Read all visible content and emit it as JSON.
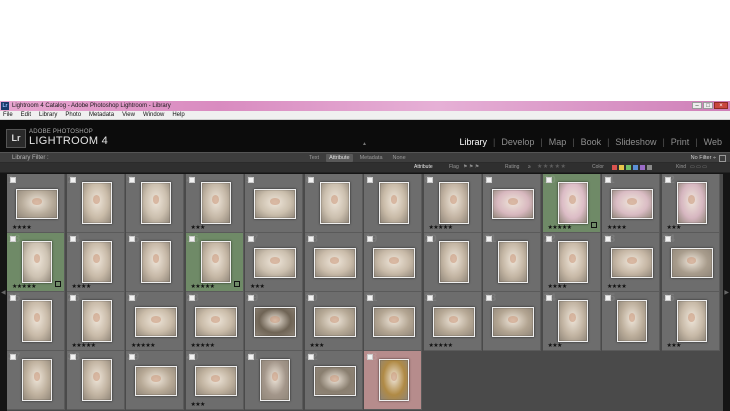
{
  "window": {
    "app_icon": "Lr",
    "title": "Lightroom 4 Catalog - Adobe Photoshop Lightroom - Library"
  },
  "menu": [
    "File",
    "Edit",
    "Library",
    "Photo",
    "Metadata",
    "View",
    "Window",
    "Help"
  ],
  "identity": {
    "logo": "Lr",
    "brand_line1": "ADOBE PHOTOSHOP",
    "brand_line2": "LIGHTROOM 4"
  },
  "modules": [
    {
      "label": "Library",
      "active": true
    },
    {
      "label": "Develop",
      "active": false
    },
    {
      "label": "Map",
      "active": false
    },
    {
      "label": "Book",
      "active": false
    },
    {
      "label": "Slideshow",
      "active": false
    },
    {
      "label": "Print",
      "active": false
    },
    {
      "label": "Web",
      "active": false
    }
  ],
  "filter_bar": {
    "label": "Library Filter :",
    "tabs": [
      {
        "label": "Text",
        "active": false
      },
      {
        "label": "Attribute",
        "active": true
      },
      {
        "label": "Metadata",
        "active": false
      },
      {
        "label": "None",
        "active": false
      }
    ],
    "preset": "No Filter ÷"
  },
  "attribute_bar": {
    "label": "Attribute",
    "flag": "Flag",
    "rating": "Rating",
    "rating_stars": "★★★★★",
    "color": "Color",
    "kind": "Kind",
    "color_swatches": [
      "#d9534f",
      "#e8c44a",
      "#6fbf6a",
      "#5b8fd6",
      "#9a6bc7",
      "#8a8a8a"
    ]
  },
  "grid": {
    "columns": 12,
    "cells": [
      {
        "num": "1",
        "rating": 4,
        "state": "normal",
        "orient": "land",
        "tone": "#b7ab9a"
      },
      {
        "num": "2",
        "rating": 0,
        "state": "normal",
        "orient": "port",
        "tone": "#c9bba8"
      },
      {
        "num": "3",
        "rating": 0,
        "state": "normal",
        "orient": "port",
        "tone": "#cbbfae"
      },
      {
        "num": "4",
        "rating": 3,
        "state": "normal",
        "orient": "port",
        "tone": "#c4b7a6"
      },
      {
        "num": "5",
        "rating": 0,
        "state": "normal",
        "orient": "land",
        "tone": "#cbbfad"
      },
      {
        "num": "6",
        "rating": 0,
        "state": "normal",
        "orient": "port",
        "tone": "#cbbfae"
      },
      {
        "num": "7",
        "rating": 0,
        "state": "normal",
        "orient": "port",
        "tone": "#c8baa7"
      },
      {
        "num": "8",
        "rating": 5,
        "state": "normal",
        "orient": "port",
        "tone": "#c2b3a2"
      },
      {
        "num": "9",
        "rating": 0,
        "state": "normal",
        "orient": "land",
        "tone": "#d8b8bf"
      },
      {
        "num": "10",
        "rating": 5,
        "state": "pick",
        "orient": "port",
        "tone": "#dcbcc6"
      },
      {
        "num": "11",
        "rating": 4,
        "state": "normal",
        "orient": "land",
        "tone": "#dabcc4"
      },
      {
        "num": "12",
        "rating": 3,
        "state": "normal",
        "orient": "port",
        "tone": "#d6b6c0"
      },
      {
        "num": "13",
        "rating": 5,
        "state": "pick",
        "orient": "port",
        "tone": "#cdc2b2"
      },
      {
        "num": "14",
        "rating": 4,
        "state": "normal",
        "orient": "port",
        "tone": "#c8baa8"
      },
      {
        "num": "15",
        "rating": 0,
        "state": "normal",
        "orient": "port",
        "tone": "#c6b8a7"
      },
      {
        "num": "16",
        "rating": 5,
        "state": "pick",
        "orient": "port",
        "tone": "#c5b7a5"
      },
      {
        "num": "17",
        "rating": 3,
        "state": "normal",
        "orient": "land",
        "tone": "#cbbfae"
      },
      {
        "num": "18",
        "rating": 0,
        "state": "normal",
        "orient": "land",
        "tone": "#cabcaa"
      },
      {
        "num": "19",
        "rating": 0,
        "state": "normal",
        "orient": "land",
        "tone": "#c8baa8"
      },
      {
        "num": "20",
        "rating": 0,
        "state": "normal",
        "orient": "port",
        "tone": "#c2b4a2"
      },
      {
        "num": "21",
        "rating": 0,
        "state": "normal",
        "orient": "port",
        "tone": "#c4b6a4"
      },
      {
        "num": "22",
        "rating": 4,
        "state": "normal",
        "orient": "port",
        "tone": "#c8b9a7"
      },
      {
        "num": "23",
        "rating": 4,
        "state": "normal",
        "orient": "land",
        "tone": "#c6b7a5"
      },
      {
        "num": "24",
        "rating": 0,
        "state": "normal",
        "orient": "land",
        "tone": "#a89c8c"
      },
      {
        "num": "25",
        "rating": 0,
        "state": "normal",
        "orient": "port",
        "tone": "#c8baa8"
      },
      {
        "num": "26",
        "rating": 5,
        "state": "normal",
        "orient": "port",
        "tone": "#c9bba9"
      },
      {
        "num": "27",
        "rating": 5,
        "state": "normal",
        "orient": "land",
        "tone": "#cabca9"
      },
      {
        "num": "28",
        "rating": 5,
        "state": "normal",
        "orient": "land",
        "tone": "#c9bba8"
      },
      {
        "num": "29",
        "rating": 0,
        "state": "normal",
        "orient": "land",
        "tone": "#6f6455"
      },
      {
        "num": "30",
        "rating": 3,
        "state": "normal",
        "orient": "land",
        "tone": "#b6a996"
      },
      {
        "num": "31",
        "rating": 0,
        "state": "normal",
        "orient": "land",
        "tone": "#b3a592"
      },
      {
        "num": "32",
        "rating": 5,
        "state": "normal",
        "orient": "land",
        "tone": "#b7a996"
      },
      {
        "num": "33",
        "rating": 0,
        "state": "normal",
        "orient": "land",
        "tone": "#b2a491"
      },
      {
        "num": "34",
        "rating": 3,
        "state": "normal",
        "orient": "port",
        "tone": "#c1b3a1"
      },
      {
        "num": "35",
        "rating": 0,
        "state": "normal",
        "orient": "port",
        "tone": "#bcae9b"
      },
      {
        "num": "36",
        "rating": 3,
        "state": "normal",
        "orient": "port",
        "tone": "#c7b9a7"
      },
      {
        "num": "37",
        "rating": 0,
        "state": "normal",
        "orient": "port",
        "tone": "#bfb19e"
      },
      {
        "num": "38",
        "rating": 0,
        "state": "normal",
        "orient": "port",
        "tone": "#c2b4a2"
      },
      {
        "num": "39",
        "rating": 0,
        "state": "normal",
        "orient": "land",
        "tone": "#b7a996"
      },
      {
        "num": "40",
        "rating": 3,
        "state": "normal",
        "orient": "land",
        "tone": "#c0b29f"
      },
      {
        "num": "41",
        "rating": 0,
        "state": "normal",
        "orient": "port",
        "tone": "#a3968a"
      },
      {
        "num": "42",
        "rating": 0,
        "state": "normal",
        "orient": "land",
        "tone": "#8a7f70"
      },
      {
        "num": "43",
        "rating": 0,
        "state": "pink",
        "orient": "port",
        "tone": "#b08a45"
      }
    ]
  }
}
